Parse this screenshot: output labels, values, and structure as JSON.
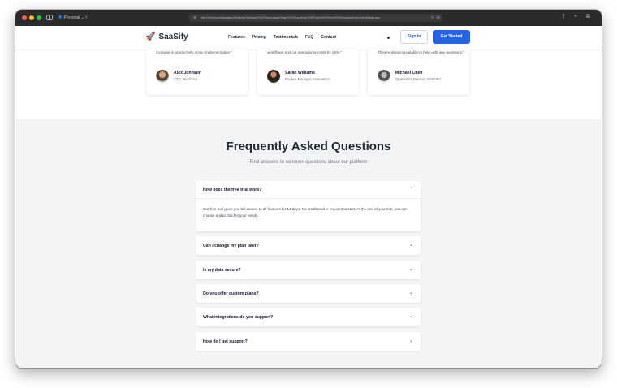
{
  "browser": {
    "profile_label": "Personal",
    "url": "file:///Users/paakalaba/Desktop/Website%20Templates/SaaS%20Landing%20Page%20Free%20Version/index.html#features",
    "back_glyph": "‹",
    "lock_glyph": "⊕",
    "reload_glyph": "↻",
    "ext_glyph": "▤",
    "share_glyph": "⇪",
    "newtab_glyph": "+",
    "tabs_glyph": "⧉"
  },
  "nav": {
    "logo_text": "SaaSify",
    "logo_glyph": "🚀",
    "links": [
      "Features",
      "Pricing",
      "Testimonials",
      "FAQ",
      "Contact"
    ],
    "signin_label": "Sign In",
    "getstarted_label": "Get Started"
  },
  "testimonials": [
    {
      "quote": "increase in productivity since implementation.\"",
      "name": "Alex Johnson",
      "role": "CTO, TechCorp"
    },
    {
      "quote": "workflows and cut operational costs by 25%.\"",
      "name": "Sarah Williams",
      "role": "Product Manager, InnovateCo"
    },
    {
      "quote": "They're always available to help with any questions.\"",
      "name": "Michael Chen",
      "role": "Operations Director, GlobalBiz"
    }
  ],
  "faq": {
    "title": "Frequently Asked Questions",
    "subtitle": "Find answers to common questions about our platform",
    "items": [
      {
        "question": "How does the free trial work?",
        "chevron": "⌃",
        "answer": "Our free trial gives you full access to all features for 14 days. No credit card is required to start. At the end of your trial, you can choose a plan that fits your needs."
      },
      {
        "question": "Can I change my plan later?",
        "chevron": "⌄"
      },
      {
        "question": "Is my data secure?",
        "chevron": "⌄"
      },
      {
        "question": "Do you offer custom plans?",
        "chevron": "⌄"
      },
      {
        "question": "What integrations do you support?",
        "chevron": "⌄"
      },
      {
        "question": "How do I get support?",
        "chevron": "⌄"
      }
    ]
  },
  "colors": {
    "brand_blue": "#2563eb",
    "logo_orange": "#e85d2a",
    "section_bg": "#f3f4f6"
  }
}
